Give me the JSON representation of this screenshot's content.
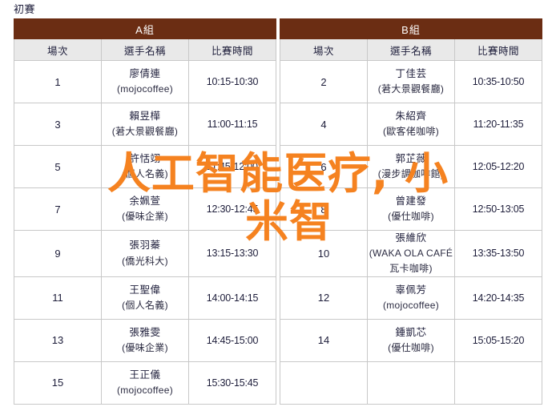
{
  "page": {
    "title": "初賽"
  },
  "watermark": {
    "color": "#F58220",
    "line1": "人工智能医疗, 小",
    "line2": "米智"
  },
  "table": {
    "groups": [
      {
        "id": "A",
        "label": "A組"
      },
      {
        "id": "B",
        "label": "B組"
      }
    ],
    "columns": {
      "match": "場次",
      "player": "選手名稱",
      "time": "比賽時間"
    },
    "rows": [
      {
        "a": {
          "match": "1",
          "player": "廖倩連",
          "team": "(mojocoffee)",
          "time": "10:15-10:30"
        },
        "b": {
          "match": "2",
          "player": "丁佳芸",
          "team": "(莙大景觀餐廳)",
          "time": "10:35-10:50"
        }
      },
      {
        "a": {
          "match": "3",
          "player": "賴昱樺",
          "team": "(莙大景觀餐廳)",
          "time": "11:00-11:15"
        },
        "b": {
          "match": "4",
          "player": "朱紹齊",
          "team": "(歐客佬咖啡)",
          "time": "11:20-11:35"
        }
      },
      {
        "a": {
          "match": "5",
          "player": "許恬翊",
          "team": "(個人名義)",
          "time": "11:45-12:00"
        },
        "b": {
          "match": "6",
          "player": "郭芷薇",
          "team": "(漫步調咖啡館)",
          "time": "12:05-12:20"
        }
      },
      {
        "a": {
          "match": "7",
          "player": "余姵萱",
          "team": "(優味企業)",
          "time": "12:30-12:45"
        },
        "b": {
          "match": "8",
          "player": "曾建發",
          "team": "(優仕咖啡)",
          "time": "12:50-13:05"
        }
      },
      {
        "a": {
          "match": "9",
          "player": "張羽蓁",
          "team": "(僑光科大)",
          "time": "13:15-13:30"
        },
        "b": {
          "match": "10",
          "player": "張維欣",
          "team": "(WAKA OLA CAFÉ 瓦卡咖啡)",
          "time": "13:35-13:50"
        }
      },
      {
        "a": {
          "match": "11",
          "player": "王聖偉",
          "team": "(個人名義)",
          "time": "14:00-14:15"
        },
        "b": {
          "match": "12",
          "player": "辜佩芳",
          "team": "(mojocoffee)",
          "time": "14:20-14:35"
        }
      },
      {
        "a": {
          "match": "13",
          "player": "張雅雯",
          "team": "(優味企業)",
          "time": "14:45-15:00"
        },
        "b": {
          "match": "14",
          "player": "鍾凱芯",
          "team": "(優仕咖啡)",
          "time": "15:05-15:20"
        }
      },
      {
        "a": {
          "match": "15",
          "player": "王正儀",
          "team": "(mojocoffee)",
          "time": "15:30-15:45"
        },
        "b": {
          "match": "",
          "player": "",
          "team": "",
          "time": ""
        }
      }
    ]
  }
}
